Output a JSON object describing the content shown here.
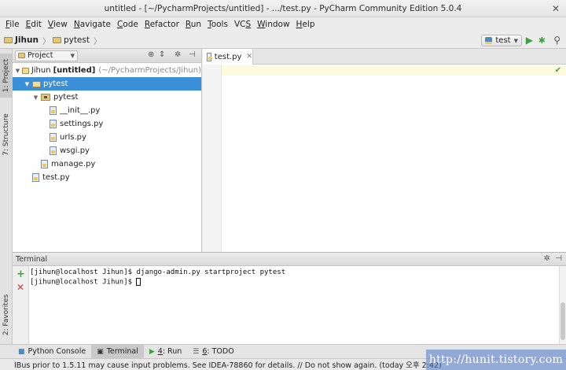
{
  "window": {
    "title": "untitled - [~/PycharmProjects/untitled] - .../test.py - PyCharm Community Edition 5.0.4"
  },
  "menu": [
    {
      "mnemonic": "F",
      "rest": "ile"
    },
    {
      "mnemonic": "E",
      "rest": "dit"
    },
    {
      "mnemonic": "V",
      "rest": "iew"
    },
    {
      "mnemonic": "N",
      "rest": "avigate"
    },
    {
      "mnemonic": "C",
      "rest": "ode"
    },
    {
      "mnemonic": "R",
      "rest": "efactor"
    },
    {
      "mnemonic": "R",
      "rest": "un"
    },
    {
      "mnemonic": "T",
      "rest": "ools"
    },
    {
      "pre": "VC",
      "mnemonic": "S",
      "rest": ""
    },
    {
      "mnemonic": "W",
      "rest": "indow"
    },
    {
      "mnemonic": "H",
      "rest": "elp"
    }
  ],
  "navbar": {
    "crumbs": [
      "Jihun",
      "pytest"
    ],
    "run_config": "test"
  },
  "leftstrip": {
    "tabs": [
      "1: Project",
      "7: Structure",
      "2: Favorites"
    ]
  },
  "project": {
    "view_label": "Project",
    "tree": [
      {
        "name": "Jihun",
        "bold_suffix": "[untitled]",
        "path": "(~/PycharmProjects/Jihun)",
        "level": 0,
        "kind": "folder"
      },
      {
        "name": "pytest",
        "level": 1,
        "kind": "folder",
        "selected": true
      },
      {
        "name": "pytest",
        "level": 2,
        "kind": "package"
      },
      {
        "name": "__init__.py",
        "level": 3,
        "kind": "py"
      },
      {
        "name": "settings.py",
        "level": 3,
        "kind": "py"
      },
      {
        "name": "urls.py",
        "level": 3,
        "kind": "py"
      },
      {
        "name": "wsgi.py",
        "level": 3,
        "kind": "py"
      },
      {
        "name": "manage.py",
        "level": 2,
        "kind": "py"
      },
      {
        "name": "test.py",
        "level": 1,
        "kind": "py"
      }
    ]
  },
  "editor": {
    "tab_label": "test.py"
  },
  "terminal": {
    "title": "Terminal",
    "lines": [
      "[jihun@localhost Jihun]$ django-admin.py startproject pytest",
      "[jihun@localhost Jihun]$ "
    ]
  },
  "bottom_tabs": [
    {
      "label": "Python Console",
      "icon": "python-console-icon"
    },
    {
      "label": "Terminal",
      "icon": "terminal-icon",
      "active": true
    },
    {
      "num": "4",
      "label": ": Run",
      "icon": "run-icon"
    },
    {
      "num": "6",
      "label": ": TODO",
      "icon": "todo-icon"
    }
  ],
  "status": {
    "message": "IBus prior to 1.5.11 may cause input problems. See IDEA-78860 for details. // Do not show again. (today 오후 2:42)"
  },
  "watermark": "http://hunit.tistory.com",
  "colors": {
    "selection": "#3b8fd8",
    "run_green": "#3ea33e",
    "current_line": "#fcfcdc"
  }
}
